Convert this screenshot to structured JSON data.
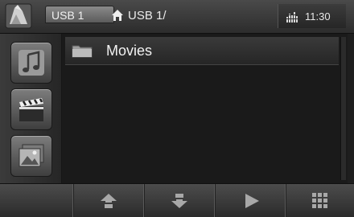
{
  "header": {
    "source_label": "USB 1",
    "path": "USB 1/",
    "clock": "11:30"
  },
  "sidebar": {
    "items": [
      {
        "icon": "music-note-icon"
      },
      {
        "icon": "clapperboard-icon"
      },
      {
        "icon": "photo-icon"
      }
    ]
  },
  "list": {
    "items": [
      {
        "label": "Movies",
        "icon": "folder-icon"
      }
    ]
  },
  "toolbar": {
    "buttons": [
      {
        "icon": "blank"
      },
      {
        "icon": "arrow-up-icon"
      },
      {
        "icon": "arrow-down-icon"
      },
      {
        "icon": "play-icon"
      },
      {
        "icon": "grid-menu-icon"
      }
    ]
  }
}
